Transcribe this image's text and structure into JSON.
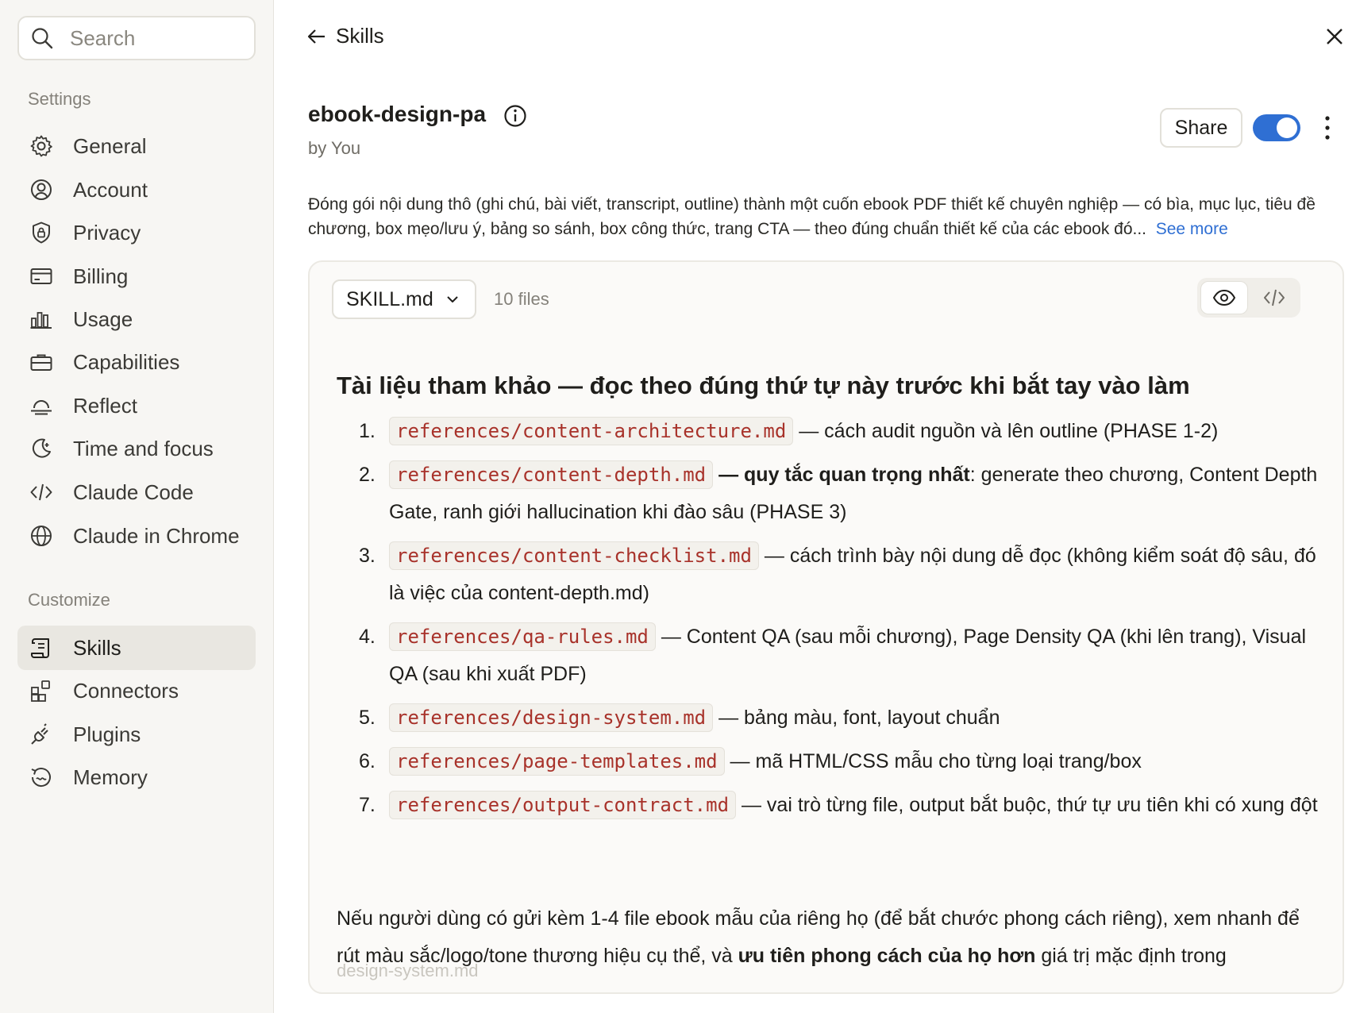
{
  "sidebar": {
    "search_placeholder": "Search",
    "settings_label": "Settings",
    "settings_items": [
      {
        "label": "General",
        "icon": "gear-icon"
      },
      {
        "label": "Account",
        "icon": "user-circle-icon"
      },
      {
        "label": "Privacy",
        "icon": "shield-lock-icon"
      },
      {
        "label": "Billing",
        "icon": "credit-card-icon"
      },
      {
        "label": "Usage",
        "icon": "bar-chart-icon"
      },
      {
        "label": "Capabilities",
        "icon": "toolbox-icon"
      },
      {
        "label": "Reflect",
        "icon": "sunrise-icon"
      },
      {
        "label": "Time and focus",
        "icon": "moon-icon"
      },
      {
        "label": "Claude Code",
        "icon": "code-icon"
      },
      {
        "label": "Claude in Chrome",
        "icon": "globe-icon"
      }
    ],
    "customize_label": "Customize",
    "customize_items": [
      {
        "label": "Skills",
        "icon": "scroll-icon",
        "active": true
      },
      {
        "label": "Connectors",
        "icon": "grid-plus-icon"
      },
      {
        "label": "Plugins",
        "icon": "plug-icon"
      },
      {
        "label": "Memory",
        "icon": "history-icon"
      }
    ]
  },
  "header": {
    "back_label": "Skills"
  },
  "skill": {
    "name": "ebook-design-pa",
    "author": "by You",
    "share_label": "Share",
    "enabled": true,
    "description": "Đóng gói nội dung thô (ghi chú, bài viết, transcript, outline) thành một cuốn ebook PDF thiết kế chuyên nghiệp — có bìa, mục lục, tiêu đề chương, box mẹo/lưu ý, bảng so sánh, box công thức, trang CTA — theo đúng chuẩn thiết kế của các ebook đó...",
    "see_more": "See more"
  },
  "panel": {
    "file_selected": "SKILL.md",
    "file_count": "10 files",
    "heading": "Tài liệu tham khảo — đọc theo đúng thứ tự này trước khi bắt tay vào làm",
    "references": [
      {
        "num": "1.",
        "path": "references/content-architecture.md",
        "bold": "",
        "text": " — cách audit nguồn và lên outline (PHASE 1-2)"
      },
      {
        "num": "2.",
        "path": "references/content-depth.md",
        "bold": " — quy tắc quan trọng nhất",
        "text": ": generate theo chương, Content Depth Gate, ranh giới hallucination khi đào sâu (PHASE 3)"
      },
      {
        "num": "3.",
        "path": "references/content-checklist.md",
        "bold": "",
        "text": " — cách trình bày nội dung dễ đọc (không kiểm soát độ sâu, đó là việc của content-depth.md)"
      },
      {
        "num": "4.",
        "path": "references/qa-rules.md",
        "bold": "",
        "text": " — Content QA (sau mỗi chương), Page Density QA (khi lên trang), Visual QA (sau khi xuất PDF)"
      },
      {
        "num": "5.",
        "path": "references/design-system.md",
        "bold": "",
        "text": " — bảng màu, font, layout chuẩn"
      },
      {
        "num": "6.",
        "path": "references/page-templates.md",
        "bold": "",
        "text": " — mã HTML/CSS mẫu cho từng loại trang/box"
      },
      {
        "num": "7.",
        "path": "references/output-contract.md",
        "bold": "",
        "text": " — vai trò từng file, output bắt buộc, thứ tự ưu tiên khi có xung đột"
      }
    ],
    "closing_before": "Nếu người dùng có gửi kèm 1-4 file ebook mẫu của riêng họ (để bắt chước phong cách riêng), xem nhanh để rút màu sắc/logo/tone thương hiệu cụ thể, và ",
    "closing_bold": "ưu tiên phong cách của họ hơn",
    "closing_after": " giá trị mặc định trong",
    "closing_fade": "design-system.md"
  },
  "colors": {
    "accent": "#2f6fd3",
    "code_text": "#a8322a",
    "sidebar_bg": "#f7f6f3",
    "active_item_bg": "#e9e7e1"
  }
}
